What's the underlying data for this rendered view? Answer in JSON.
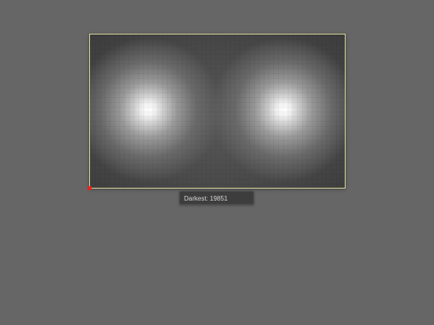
{
  "image_view": {
    "tooltip": {
      "text": "Darkest: 19851"
    },
    "marker": {
      "color": "#e8231f"
    },
    "frame": {
      "border_color": "#d8d89a"
    },
    "background_color": "#666666"
  }
}
